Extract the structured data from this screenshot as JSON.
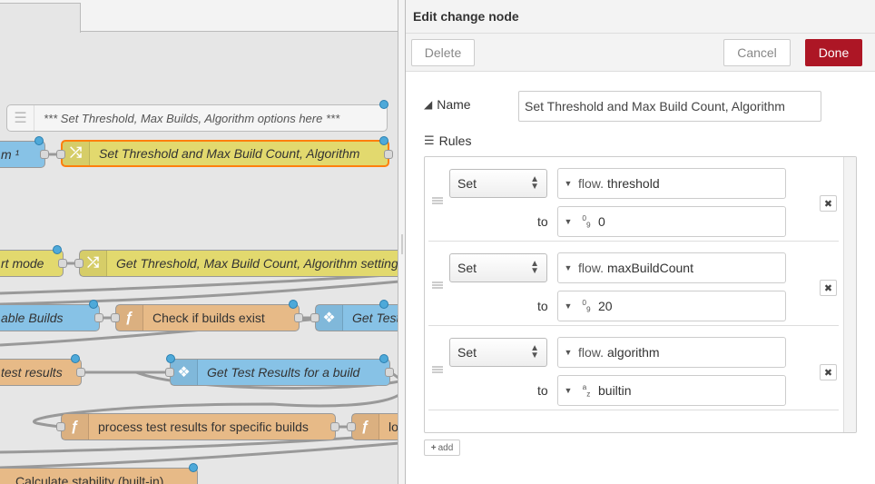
{
  "workspace": {
    "nodes": [
      {
        "label": "*** Set Threshold, Max Builds, Algorithm options here ***"
      },
      {
        "label": "m ¹"
      },
      {
        "label": "Set Threshold and Max Build Count, Algorithm"
      },
      {
        "label": "rt mode"
      },
      {
        "label": "Get Threshold, Max Build Count, Algorithm settings"
      },
      {
        "label": "able Builds"
      },
      {
        "label": "Check if builds exist"
      },
      {
        "label": "Get Test"
      },
      {
        "label": "test results"
      },
      {
        "label": "Get Test Results for a build"
      },
      {
        "label": "process test results for specific builds"
      },
      {
        "label": "lo"
      },
      {
        "label": "Calculate stability (built-in)"
      }
    ]
  },
  "tray": {
    "title": "Edit change node",
    "delete_label": "Delete",
    "cancel_label": "Cancel",
    "done_label": "Done",
    "name_label": "Name",
    "name_value": "Set Threshold and Max Build Count, Algorithm",
    "rules_label": "Rules",
    "to_label": "to",
    "add_label": "add",
    "rules": [
      {
        "action": "Set",
        "target_type": "flow.",
        "target": "threshold",
        "value_type_icon": "09",
        "value": "0"
      },
      {
        "action": "Set",
        "target_type": "flow.",
        "target": "maxBuildCount",
        "value_type_icon": "09",
        "value": "20"
      },
      {
        "action": "Set",
        "target_type": "flow.",
        "target": "algorithm",
        "value_type_icon": "az",
        "value": "builtin"
      }
    ]
  },
  "colors": {
    "accent": "#ad1625",
    "change_node": "#e2d96e",
    "function_node": "#e7ba87",
    "subflow_node": "#87c2e6",
    "selection": "#ff7f0e"
  }
}
